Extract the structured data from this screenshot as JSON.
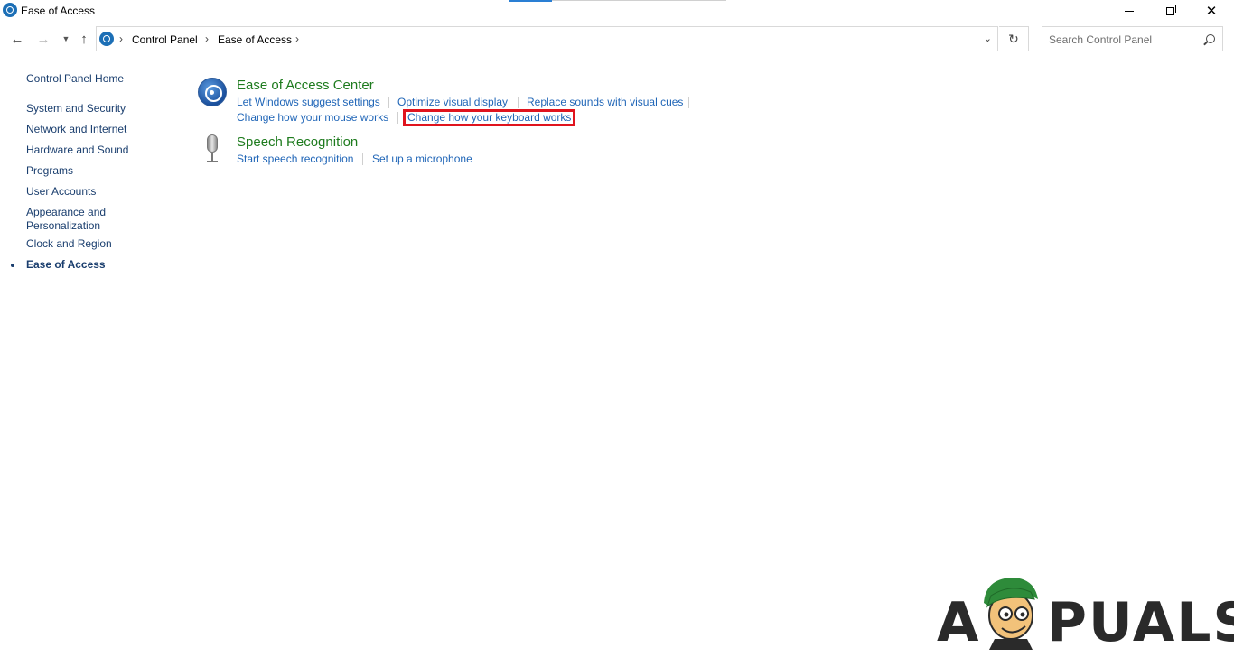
{
  "window": {
    "title": "Ease of Access"
  },
  "nav": {
    "breadcrumb": [
      "Control Panel",
      "Ease of Access"
    ],
    "search_placeholder": "Search Control Panel"
  },
  "sidebar": {
    "home": "Control Panel Home",
    "items": [
      "System and Security",
      "Network and Internet",
      "Hardware and Sound",
      "Programs",
      "User Accounts",
      "Appearance and Personalization",
      "Clock and Region",
      "Ease of Access"
    ],
    "active_item": "Ease of Access"
  },
  "categories": [
    {
      "title": "Ease of Access Center",
      "icon": "ease-of-access-icon",
      "links": [
        "Let Windows suggest settings",
        "Optimize visual display",
        "Replace sounds with visual cues",
        "Change how your mouse works",
        "Change how your keyboard works"
      ]
    },
    {
      "title": "Speech Recognition",
      "icon": "microphone-icon",
      "links": [
        "Start speech recognition",
        "Set up a microphone"
      ]
    }
  ],
  "highlighted_link": "Change how your keyboard works",
  "highlight_color": "#e0141e",
  "link_color": "#1f65b7",
  "category_title_color": "#1e7b1e",
  "watermark": {
    "text_a": "A",
    "text_rest": "PUALS"
  }
}
